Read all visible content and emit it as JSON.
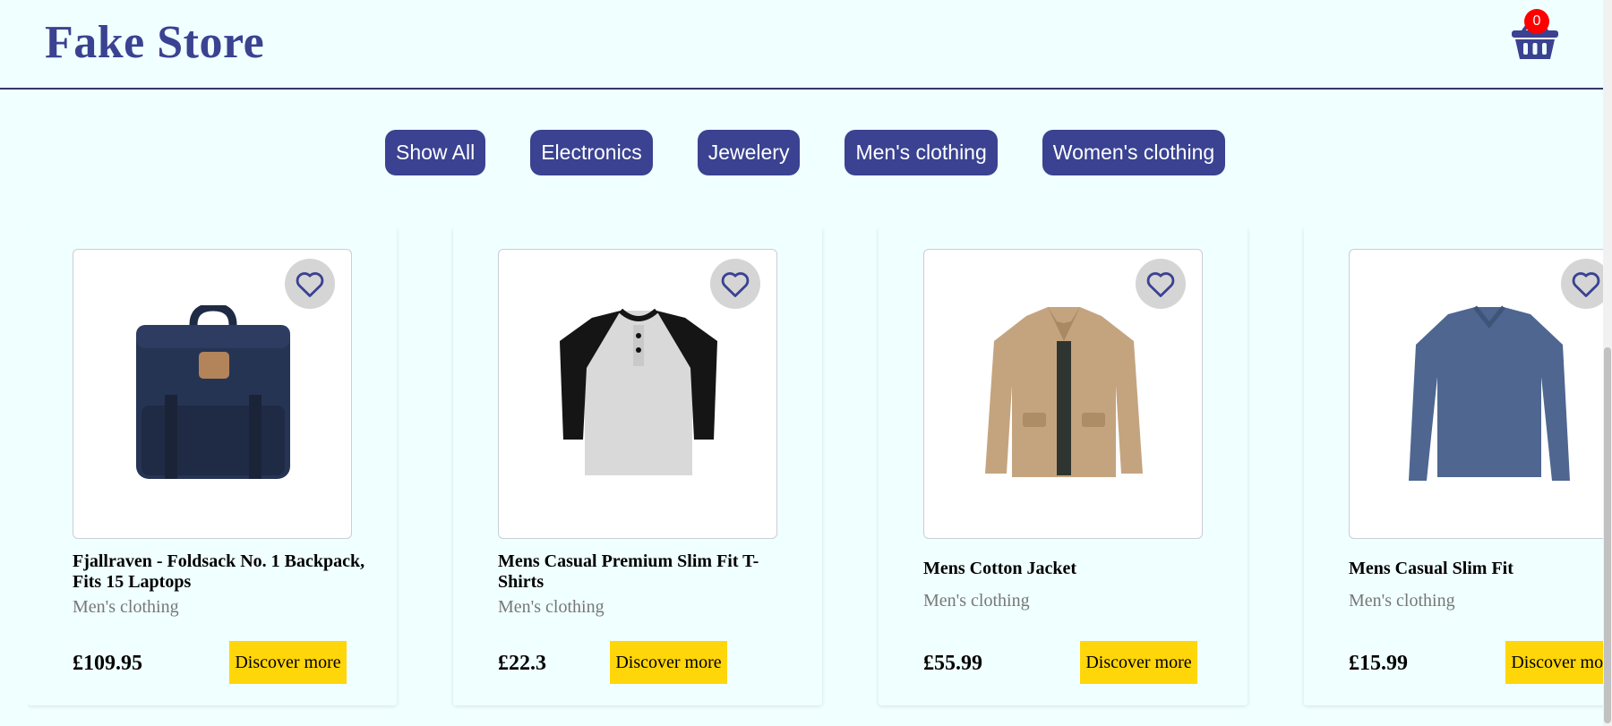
{
  "header": {
    "brand": "Fake Store",
    "cart_count": "0"
  },
  "filters": [
    "Show All",
    "Electronics",
    "Jewelery",
    "Men's clothing",
    "Women's clothing"
  ],
  "products": [
    {
      "title": "Fjallraven - Foldsack No. 1 Backpack, Fits 15 Laptops",
      "category": "Men's clothing",
      "price": "£109.95",
      "cta": "Discover more",
      "icon": "backpack-image"
    },
    {
      "title": "Mens Casual Premium Slim Fit T-Shirts",
      "category": "Men's clothing",
      "price": "£22.3",
      "cta": "Discover more",
      "icon": "tshirt-image"
    },
    {
      "title": "Mens Cotton Jacket",
      "category": "Men's clothing",
      "price": "£55.99",
      "cta": "Discover more",
      "icon": "jacket-image"
    },
    {
      "title": "Mens Casual Slim Fit",
      "category": "Men's clothing",
      "price": "£15.99",
      "cta": "Discover more",
      "icon": "longsleeve-image"
    }
  ],
  "colors": {
    "background": "#f0ffff",
    "brand": "#3a4291",
    "cta": "#ffd60a",
    "badge": "#ff0000"
  }
}
